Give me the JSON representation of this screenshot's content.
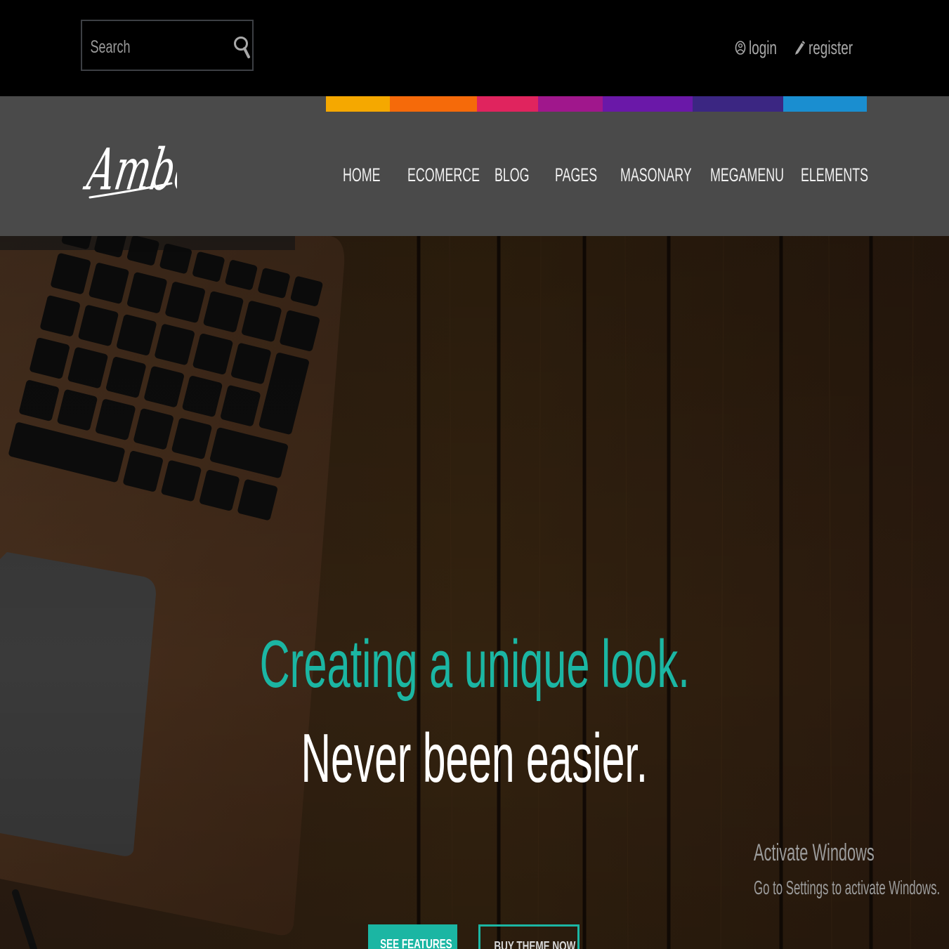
{
  "topbar": {
    "search": {
      "placeholder": "Search",
      "value": "",
      "icon": "search-icon"
    },
    "login": {
      "label": "login",
      "icon": "user-circle-icon"
    },
    "register": {
      "label": "register",
      "icon": "pencil-icon"
    }
  },
  "navbar": {
    "color_strip": [
      "#f5a800",
      "#f56a0a",
      "#e0245e",
      "#a0178c",
      "#6a18a8",
      "#3b2682",
      "#1a8ed0"
    ],
    "logo_text": "Amber",
    "items": [
      {
        "label": "HOME"
      },
      {
        "label": "ECOMERCE"
      },
      {
        "label": "BLOG"
      },
      {
        "label": "PAGES"
      },
      {
        "label": "MASONARY"
      },
      {
        "label": "MEGAMENU"
      },
      {
        "label": "ELEMENTS"
      }
    ]
  },
  "hero": {
    "heading": "Creating a unique look.",
    "subheading": "Never been easier.",
    "accent_color": "#1bb6a3",
    "buttons": [
      {
        "label": "SEE FEATURES"
      },
      {
        "label": "BUY THEME NOW"
      }
    ]
  },
  "watermark": {
    "title": "Activate Windows",
    "subtitle": "Go to Settings to activate Windows."
  }
}
